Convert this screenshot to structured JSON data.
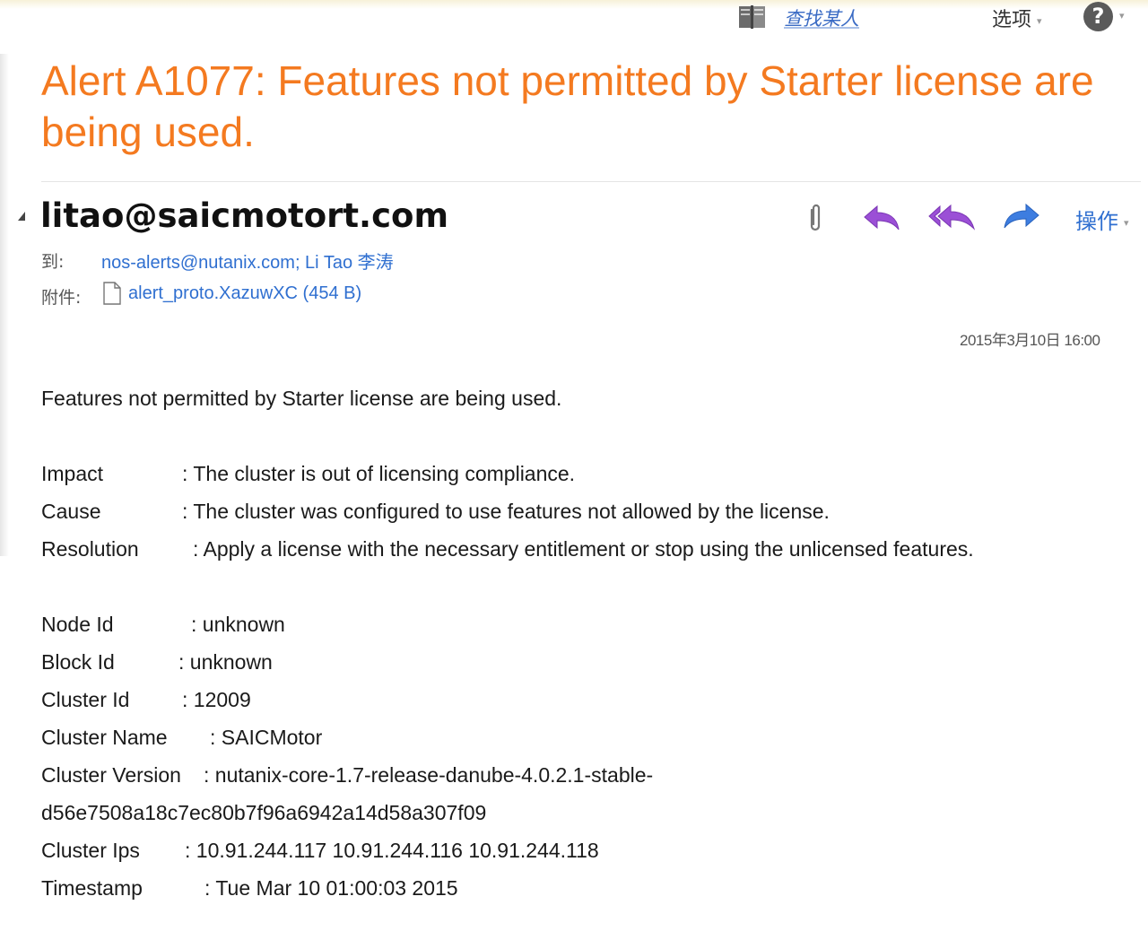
{
  "toolbar": {
    "find_person": "查找某人",
    "options_label": "选项",
    "help_glyph": "?",
    "caret": "▾"
  },
  "email": {
    "subject": "Alert A1077: Features not permitted by Starter license are being used.",
    "sender": "litao@saicmotort.com",
    "actions_label": "操作",
    "to_label": "到:",
    "recipients": "nos-alerts@nutanix.com; Li Tao 李涛",
    "attachments_label": "附件:",
    "attachment": "alert_proto.XazuwXC (454 B)",
    "date": "2015年3月10日 16:00"
  },
  "body": {
    "intro": "Features not permitted by Starter license are being used.",
    "impact_label": "Impact",
    "impact_value": ": The cluster is out of licensing compliance.",
    "cause_label": "Cause",
    "cause_value": ": The cluster was configured to use features not allowed by the license.",
    "resolution_label": "Resolution",
    "resolution_value": ": Apply a license with the necessary entitlement or stop using the unlicensed features.",
    "node_id_label": "Node Id",
    "node_id_value": ": unknown",
    "block_id_label": "Block Id",
    "block_id_value": ": unknown",
    "cluster_id_label": "Cluster Id",
    "cluster_id_value": ": 12009",
    "cluster_name_label": "Cluster Name",
    "cluster_name_value": ": SAICMotor",
    "cluster_version_label": "Cluster Version",
    "cluster_version_value": ": nutanix-core-1.7-release-danube-4.0.2.1-stable-",
    "cluster_version_cont": "d56e7508a18c7ec80b7f96a6942a14d58a307f09",
    "cluster_ips_label": "Cluster Ips",
    "cluster_ips_value": ": 10.91.244.117 10.91.244.116 10.91.244.118",
    "timestamp_label": "Timestamp",
    "timestamp_value": ": Tue Mar 10 01:00:03 2015"
  },
  "colors": {
    "subject": "#f47a20",
    "link": "#2f6fd0",
    "reply_purple": "#9b4fd6",
    "forward_blue": "#3d7de0"
  },
  "icons": [
    "address-book-icon",
    "help-icon",
    "paperclip-icon",
    "reply-icon",
    "reply-all-icon",
    "forward-icon",
    "file-icon",
    "collapse-triangle-icon"
  ]
}
